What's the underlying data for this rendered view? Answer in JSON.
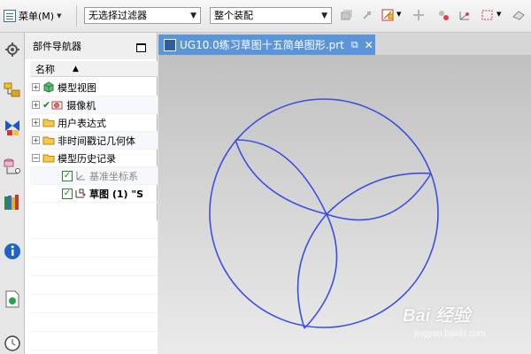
{
  "toolbar": {
    "menu_label": "菜单(M)",
    "filter_value": "无选择过滤器",
    "assembly_value": "整个装配"
  },
  "navigator": {
    "title": "部件导航器",
    "column_name": "名称",
    "items": [
      {
        "label": "模型视图",
        "icon": "model-views-icon"
      },
      {
        "label": "摄像机",
        "icon": "camera-icon"
      },
      {
        "label": "用户表达式",
        "icon": "folder-icon"
      },
      {
        "label": "非时间戳记几何体",
        "icon": "folder-icon"
      },
      {
        "label": "模型历史记录",
        "icon": "folder-icon"
      },
      {
        "label": "基准坐标系",
        "icon": "datum-csys-icon"
      },
      {
        "label": "草图 (1) \"S",
        "icon": "sketch-icon"
      }
    ]
  },
  "tab": {
    "title": "UG10.0练习草图十五简单图形.prt"
  },
  "watermark": {
    "brand": "Bai 经验",
    "url": "jingyan.baidu.com"
  },
  "colors": {
    "sketch_line": "#3a4fe0",
    "tab_active": "#5b95d9"
  }
}
